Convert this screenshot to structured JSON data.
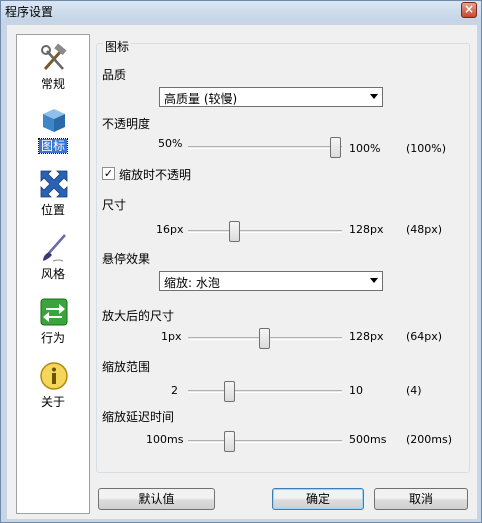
{
  "window": {
    "title": "程序设置",
    "close_glyph": "×"
  },
  "sidebar": {
    "items": [
      {
        "label": "常规",
        "icon": "tools-icon"
      },
      {
        "label": "图标",
        "icon": "blue-box-icon",
        "selected": true
      },
      {
        "label": "位置",
        "icon": "move-arrows-icon"
      },
      {
        "label": "风格",
        "icon": "paint-brush-icon"
      },
      {
        "label": "行为",
        "icon": "green-arrows-icon"
      },
      {
        "label": "关于",
        "icon": "info-icon"
      }
    ]
  },
  "panel": {
    "group_title": "图标",
    "quality": {
      "label": "品质",
      "value": "高质量 (较慢)"
    },
    "opacity": {
      "label": "不透明度",
      "min": "50%",
      "max": "100%",
      "current": "(100%)",
      "fraction": 1.0
    },
    "zoom_opaque": {
      "label": "缩放时不透明",
      "checked": true,
      "check_glyph": "✓"
    },
    "size": {
      "label": "尺寸",
      "min": "16px",
      "max": "128px",
      "current": "(48px)",
      "fraction": 0.29
    },
    "hover_effect": {
      "label": "悬停效果",
      "value": "缩放: 水泡"
    },
    "zoomed_size": {
      "label": "放大后的尺寸",
      "min": "1px",
      "max": "128px",
      "current": "(64px)",
      "fraction": 0.5
    },
    "zoom_range": {
      "label": "缩放范围",
      "min": "2",
      "max": "10",
      "current": "(4)",
      "fraction": 0.25
    },
    "zoom_delay": {
      "label": "缩放延迟时间",
      "min": "100ms",
      "max": "500ms",
      "current": "(200ms)",
      "fraction": 0.25
    }
  },
  "buttons": {
    "defaults": "默认值",
    "ok": "确定",
    "cancel": "取消"
  },
  "colors": {
    "selection": "#3875d7",
    "frame": "#c7d5e6"
  }
}
